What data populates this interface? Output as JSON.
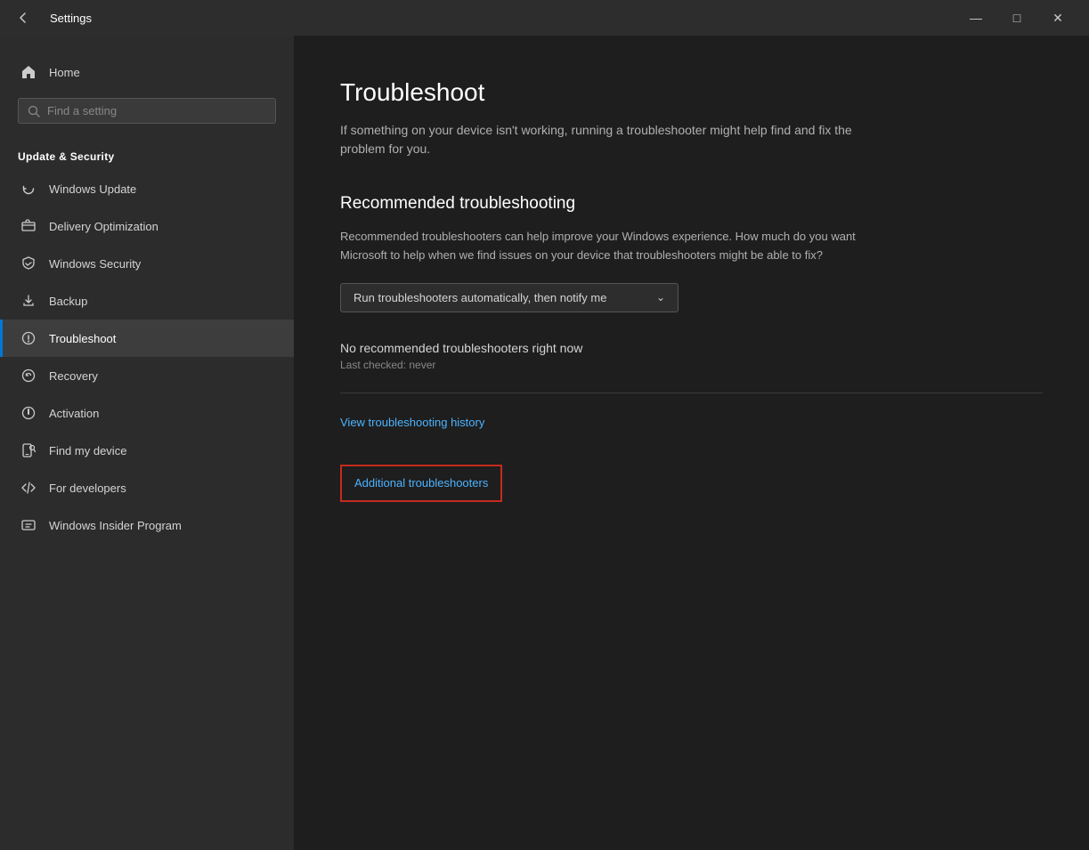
{
  "titlebar": {
    "back_label": "←",
    "title": "Settings",
    "minimize_label": "—",
    "maximize_label": "□",
    "close_label": "✕"
  },
  "sidebar": {
    "home_label": "Home",
    "search_placeholder": "Find a setting",
    "search_icon": "search-icon",
    "section_title": "Update & Security",
    "nav_items": [
      {
        "id": "windows-update",
        "label": "Windows Update",
        "icon": "update-icon"
      },
      {
        "id": "delivery-optimization",
        "label": "Delivery Optimization",
        "icon": "delivery-icon"
      },
      {
        "id": "windows-security",
        "label": "Windows Security",
        "icon": "shield-icon"
      },
      {
        "id": "backup",
        "label": "Backup",
        "icon": "backup-icon"
      },
      {
        "id": "troubleshoot",
        "label": "Troubleshoot",
        "icon": "troubleshoot-icon",
        "active": true
      },
      {
        "id": "recovery",
        "label": "Recovery",
        "icon": "recovery-icon"
      },
      {
        "id": "activation",
        "label": "Activation",
        "icon": "activation-icon"
      },
      {
        "id": "find-my-device",
        "label": "Find my device",
        "icon": "find-device-icon"
      },
      {
        "id": "for-developers",
        "label": "For developers",
        "icon": "developers-icon"
      },
      {
        "id": "windows-insider",
        "label": "Windows Insider Program",
        "icon": "insider-icon"
      }
    ]
  },
  "main": {
    "page_title": "Troubleshoot",
    "page_subtitle": "If something on your device isn't working, running a troubleshooter might help find and fix the problem for you.",
    "recommended_title": "Recommended troubleshooting",
    "recommended_desc": "Recommended troubleshooters can help improve your Windows experience. How much do you want Microsoft to help when we find issues on your device that troubleshooters might be able to fix?",
    "dropdown_value": "Run troubleshooters automatically, then notify me",
    "status_text": "No recommended troubleshooters right now",
    "last_checked": "Last checked: never",
    "view_history_link": "View troubleshooting history",
    "additional_link": "Additional troubleshooters"
  }
}
